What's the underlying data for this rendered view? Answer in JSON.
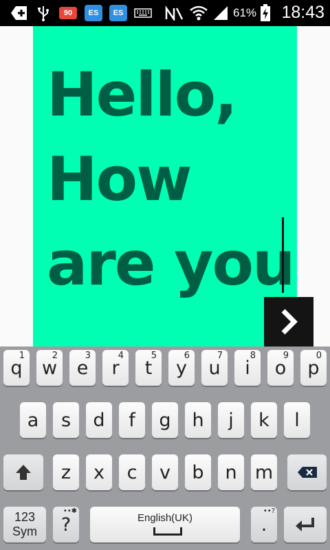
{
  "status_bar": {
    "notification_badge": "90",
    "es_label_1": "ES",
    "es_label_2": "ES",
    "battery_percent": "61%",
    "time": "18:43"
  },
  "editor": {
    "lines": [
      "Hello,",
      "How",
      "are you"
    ],
    "background_color": "#00ffb3",
    "text_color": "#005e44"
  },
  "next_button": {
    "icon": "chevron-right-icon"
  },
  "keyboard": {
    "row1": [
      {
        "key": "q",
        "hint": "1"
      },
      {
        "key": "w",
        "hint": "2"
      },
      {
        "key": "e",
        "hint": "3"
      },
      {
        "key": "r",
        "hint": "4"
      },
      {
        "key": "t",
        "hint": "5"
      },
      {
        "key": "y",
        "hint": "6"
      },
      {
        "key": "u",
        "hint": "7"
      },
      {
        "key": "i",
        "hint": "8"
      },
      {
        "key": "o",
        "hint": "9"
      },
      {
        "key": "p",
        "hint": "0"
      }
    ],
    "row2": [
      "a",
      "s",
      "d",
      "f",
      "g",
      "h",
      "j",
      "k",
      "l"
    ],
    "row3": [
      "z",
      "x",
      "c",
      "v",
      "b",
      "n",
      "m"
    ],
    "sym_label_line1": "123",
    "sym_label_line2": "Sym",
    "question_key": "?",
    "space_label": "English(UK)",
    "period_key": ".",
    "question_hint": "••✱",
    "period_hint": "••?"
  }
}
